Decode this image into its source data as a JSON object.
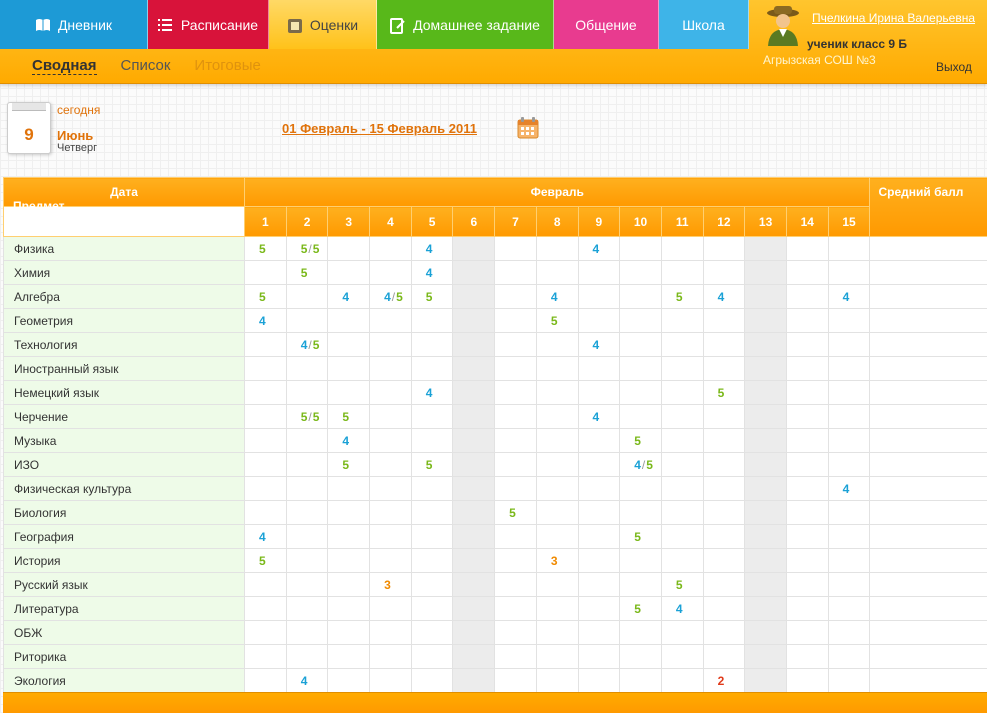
{
  "nav": {
    "tabs": [
      {
        "label": "Дневник",
        "icon": "book-icon",
        "color": "#1d9ad6",
        "width": 148
      },
      {
        "label": "Расписание",
        "icon": "list-icon",
        "color": "#d8133a",
        "width": 121
      },
      {
        "label": "Оценки",
        "icon": "gradebook-icon",
        "color": "#ffc21a",
        "width": 108,
        "active": true
      },
      {
        "label": "Домашнее задание",
        "icon": "homework-icon",
        "color": "#58b81a",
        "width": 177
      },
      {
        "label": "Общение",
        "icon": "",
        "color": "#e83b8f",
        "width": 105
      },
      {
        "label": "Школа",
        "icon": "",
        "color": "#3eb4e8",
        "width": 90
      }
    ],
    "subtabs": [
      {
        "label": "Сводная",
        "state": "active"
      },
      {
        "label": "Список",
        "state": "normal"
      },
      {
        "label": "Итоговые",
        "state": "disabled"
      }
    ]
  },
  "user": {
    "name": "Пчелкина Ирина Валерьевна",
    "role": "ученик класс 9 Б",
    "school": "Агрызская СОШ №3",
    "logout": "Выход"
  },
  "today": {
    "label": "сегодня",
    "day": "9",
    "month": "Июнь",
    "weekday": "Четверг"
  },
  "period": "01 Февраль - 15 Февраль 2011",
  "table": {
    "header_date": "Дата",
    "header_subject": "Предмет",
    "header_month": "Февраль",
    "header_avg": "Средний балл",
    "days": [
      "1",
      "2",
      "3",
      "4",
      "5",
      "6",
      "7",
      "8",
      "9",
      "10",
      "11",
      "12",
      "13",
      "14",
      "15"
    ],
    "gray_days": [
      "6",
      "13"
    ],
    "rows": [
      {
        "subject": "Физика",
        "grades": {
          "1": "5",
          "2": "5/5",
          "5": "4",
          "9": "4"
        }
      },
      {
        "subject": "Химия",
        "grades": {
          "2": "5",
          "5": "4"
        }
      },
      {
        "subject": "Алгебра",
        "grades": {
          "1": "5",
          "3": "4",
          "4": "4/5",
          "5": "5",
          "8": "4",
          "11": "5",
          "12": "4",
          "15": "4"
        }
      },
      {
        "subject": "Геометрия",
        "grades": {
          "1": "4",
          "8": "5"
        }
      },
      {
        "subject": "Технология",
        "grades": {
          "2": "4/5",
          "9": "4"
        }
      },
      {
        "subject": "Иностранный язык",
        "grades": {}
      },
      {
        "subject": "Немецкий язык",
        "grades": {
          "5": "4",
          "12": "5"
        }
      },
      {
        "subject": "Черчение",
        "grades": {
          "2": "5/5",
          "3": "5",
          "9": "4"
        }
      },
      {
        "subject": "Музыка",
        "grades": {
          "3": "4",
          "10": "5"
        }
      },
      {
        "subject": "ИЗО",
        "grades": {
          "3": "5",
          "5": "5",
          "10": "4/5"
        }
      },
      {
        "subject": "Физическая культура",
        "grades": {
          "15": "4"
        }
      },
      {
        "subject": "Биология",
        "grades": {
          "7": "5"
        }
      },
      {
        "subject": "География",
        "grades": {
          "1": "4",
          "10": "5"
        }
      },
      {
        "subject": "История",
        "grades": {
          "1": "5",
          "8": "3"
        }
      },
      {
        "subject": "Русский язык",
        "grades": {
          "4": "3",
          "11": "5"
        }
      },
      {
        "subject": "Литература",
        "grades": {
          "10": "5",
          "11": "4"
        }
      },
      {
        "subject": "ОБЖ",
        "grades": {}
      },
      {
        "subject": "Риторика",
        "grades": {}
      },
      {
        "subject": "Экология",
        "grades": {
          "2": "4",
          "12": "2"
        }
      }
    ]
  }
}
